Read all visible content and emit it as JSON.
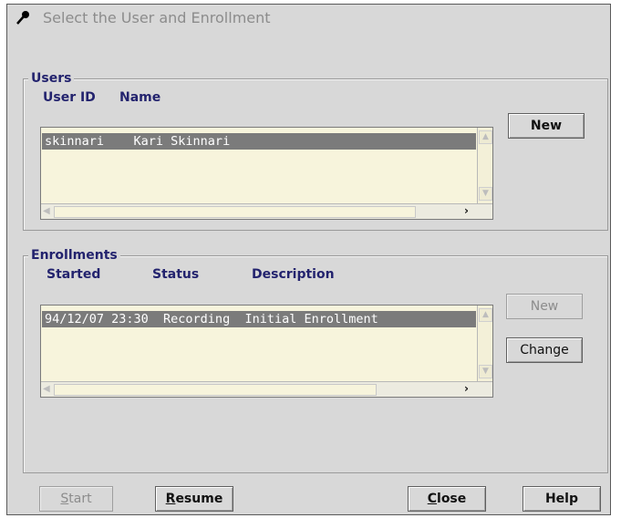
{
  "window": {
    "title": "Select the User and Enrollment"
  },
  "users": {
    "legend": "Users",
    "columns": [
      "User ID",
      "Name"
    ],
    "rows": [
      "skinnari    Kari Skinnari"
    ],
    "new_button": "New"
  },
  "enrollments": {
    "legend": "Enrollments",
    "columns": [
      "Started",
      "Status",
      "Description"
    ],
    "rows": [
      "94/12/07 23:30  Recording  Initial Enrollment"
    ],
    "new_button": "New",
    "change_button": "Change"
  },
  "footer": {
    "start_mnemonic": "S",
    "start_rest": "tart",
    "resume_mnemonic": "R",
    "resume_rest": "esume",
    "close_mnemonic": "C",
    "close_rest": "lose",
    "help_label": "Help"
  },
  "icons": {
    "title": "microphone-icon",
    "scroll_up": "arrow-up-icon",
    "scroll_down": "arrow-down-icon",
    "scroll_left": "arrow-left-icon",
    "scroll_right": "arrow-right-icon"
  }
}
